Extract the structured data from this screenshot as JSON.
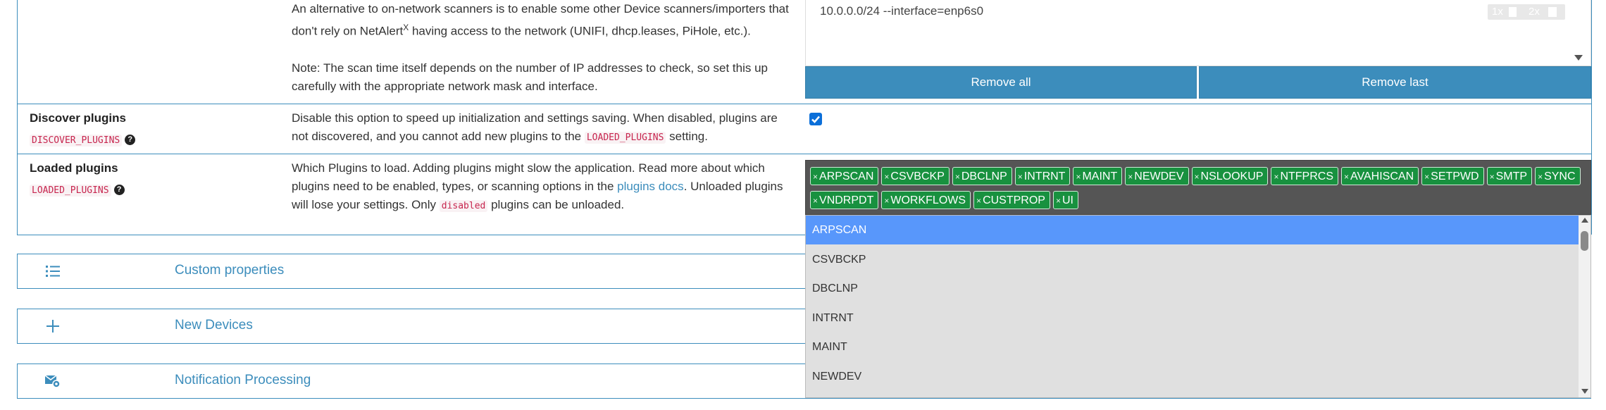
{
  "scan_setting": {
    "desc_line1": "An alternative to on-network scanners is to enable some other Device scanners/importers that",
    "desc_line2_pre": "don't rely on NetAlert",
    "desc_line2_sup": "X",
    "desc_line2_post": " having access to the network (UNIFI, dhcp.leases, PiHole, etc.).",
    "note_line1": "Note: The scan time itself depends on the number of IP addresses to check, so set this up",
    "note_line2": "carefully with the appropriate network mask and interface.",
    "subnet_value": "10.0.0.0/24 --interface=enp6s0",
    "zoom_1x": "1x",
    "zoom_2x": "2x",
    "remove_all_label": "Remove all",
    "remove_last_label": "Remove last"
  },
  "discover_plugins": {
    "title": "Discover plugins",
    "code": "DISCOVER_PLUGINS",
    "help": "?",
    "desc_line1": "Disable this option to speed up initialization and settings saving. When disabled, plugins are",
    "desc_line2_pre": "not discovered, and you cannot add new plugins to the ",
    "desc_line2_code": "LOADED_PLUGINS",
    "desc_line2_post": " setting.",
    "checked": true
  },
  "loaded_plugins": {
    "title": "Loaded plugins",
    "code": "LOADED_PLUGINS",
    "help": "?",
    "desc_line1": "Which Plugins to load. Adding plugins might slow the application. Read more about which",
    "desc_line2_pre": "plugins need to be enabled, types, or scanning options in the ",
    "desc_line2_link": "plugins docs",
    "desc_line2_post": ". Unloaded plugins",
    "desc_line3_pre": "will lose your settings. Only ",
    "desc_line3_code": "disabled",
    "desc_line3_post": " plugins can be unloaded.",
    "tag_remove_glyph": "×",
    "selected_tags": [
      "ARPSCAN",
      "CSVBCKP",
      "DBCLNP",
      "INTRNT",
      "MAINT",
      "NEWDEV",
      "NSLOOKUP",
      "NTFPRCS",
      "AVAHISCAN",
      "SETPWD",
      "SMTP",
      "SYNC",
      "VNDRPDT",
      "WORKFLOWS",
      "CUSTPROP",
      "UI"
    ],
    "dropdown_options": [
      "ARPSCAN",
      "CSVBCKP",
      "DBCLNP",
      "INTRNT",
      "MAINT",
      "NEWDEV"
    ],
    "highlighted_option": "ARPSCAN"
  },
  "sections": [
    {
      "title": "Custom properties",
      "icon": "list-icon"
    },
    {
      "title": "New Devices",
      "icon": "plus-icon"
    },
    {
      "title": "Notification Processing",
      "icon": "envelope-gear-icon"
    }
  ],
  "colors": {
    "accent": "#3c8dbc",
    "tag_green": "#18913f",
    "dropdown_highlight": "#5897fb",
    "tags_bg": "#555555"
  }
}
